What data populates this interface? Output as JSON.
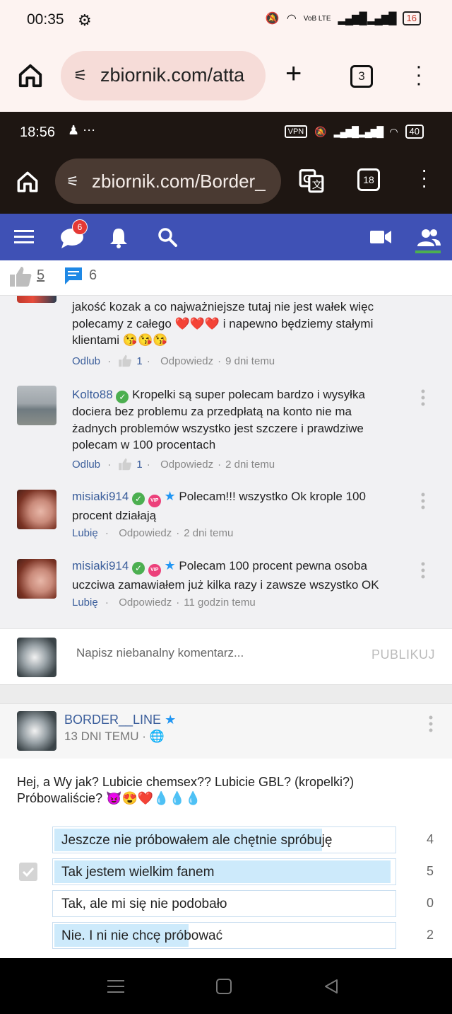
{
  "outer_status": {
    "time": "00:35",
    "network": "VoB LTE",
    "battery": "16"
  },
  "outer_browser": {
    "url": "zbiornik.com/atta",
    "tab_count": "3"
  },
  "inner_status": {
    "time": "18:56",
    "extra": "⋯",
    "vpn": "VPN",
    "battery": "40"
  },
  "inner_browser": {
    "url": "zbiornik.com/Border_",
    "tab_count": "18"
  },
  "site_nav": {
    "messages_badge": "6"
  },
  "post_actions": {
    "likes": "5",
    "comments": "6"
  },
  "comments": [
    {
      "author": "",
      "text": "jakość kozak a co najważniejsze tutaj nie jest wałek więc polecamy z całego ❤️❤️❤️ i napewno będziemy stałymi klientami 😘😘😘",
      "action": "Odlub",
      "likes": "1",
      "reply": "Odpowiedz",
      "time": "9 dni temu"
    },
    {
      "author": "Kolto88",
      "text": "Kropelki są super polecam bardzo i wysyłka dociera bez problemu za przedpłatą na konto nie ma żadnych problemów wszystko jest szczere i prawdziwe polecam w 100 procentach",
      "action": "Odlub",
      "likes": "1",
      "reply": "Odpowiedz",
      "time": "2 dni temu"
    },
    {
      "author": "misiaki914",
      "vip": "VIP",
      "text": "Polecam!!! wszystko Ok krople 100 procent działają",
      "action": "Lubię",
      "reply": "Odpowiedz",
      "time": "2 dni temu"
    },
    {
      "author": "misiaki914",
      "vip": "VIP",
      "text": "Polecam 100 procent pewna osoba uczciwa zamawiałem już kilka razy i zawsze wszystko OK",
      "action": "Lubię",
      "reply": "Odpowiedz",
      "time": "11 godzin temu"
    }
  ],
  "comment_box": {
    "placeholder": "Napisz niebanalny komentarz...",
    "publish": "PUBLIKUJ"
  },
  "post": {
    "author": "BORDER__LINE",
    "date": "13 DNI TEMU ·",
    "text": "Hej, a Wy jak? Lubicie chemsex?? Lubicie GBL? (kropelki?) Próbowaliście? 😈😍❤️💧💧💧"
  },
  "poll": [
    {
      "label": "Jeszcze nie próbowałem ale chętnie spróbuję",
      "count": "4",
      "fill": 0.79,
      "selected": false
    },
    {
      "label": "Tak jestem wielkim fanem",
      "count": "5",
      "fill": 0.99,
      "selected": true
    },
    {
      "label": "Tak, ale mi się nie podobało",
      "count": "0",
      "fill": 0,
      "selected": false
    },
    {
      "label": "Nie. I ni nie chcę próbować",
      "count": "2",
      "fill": 0.4,
      "selected": false
    }
  ],
  "colors": {
    "nav_blue": "#3f51b5",
    "link_blue": "#3b5e9b",
    "active_green": "#4caf50",
    "poll_fill": "#cdeafb"
  }
}
